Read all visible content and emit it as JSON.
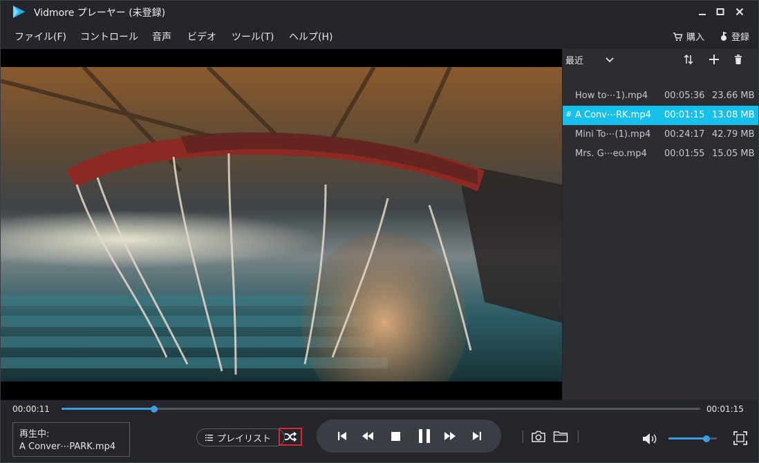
{
  "app": {
    "title": "Vidmore プレーヤー (未登録)"
  },
  "menu": {
    "items": [
      "ファイル(F)",
      "コントロール",
      "音声",
      "ビデオ",
      "ツール(T)",
      "ヘルプ(H)"
    ],
    "buy_label": "購入",
    "register_label": "登録"
  },
  "playlist": {
    "filter_label": "最近",
    "items": [
      {
        "name": "How to⋯1).mp4",
        "duration": "00:05:36",
        "size": "23.66 MB",
        "active": false
      },
      {
        "name": "A Conv⋯RK.mp4",
        "duration": "00:01:15",
        "size": "13.08 MB",
        "active": true,
        "marker": "#"
      },
      {
        "name": "Mini To⋯(1).mp4",
        "duration": "00:24:17",
        "size": "42.79 MB",
        "active": false
      },
      {
        "name": "Mrs. G⋯eo.mp4",
        "duration": "00:01:55",
        "size": "15.05 MB",
        "active": false
      }
    ]
  },
  "player": {
    "current_time": "00:00:11",
    "total_time": "00:01:15",
    "progress": 0.145,
    "volume": 0.78
  },
  "now_playing": {
    "label": "再生中:",
    "file": "A Conver⋯PARK.mp4"
  },
  "controls": {
    "playlist_label": "プレイリスト"
  },
  "colors": {
    "accent": "#3d9fe0",
    "active_row": "#17c0ea",
    "highlight_border": "#e0262d",
    "background": "#24262c"
  }
}
